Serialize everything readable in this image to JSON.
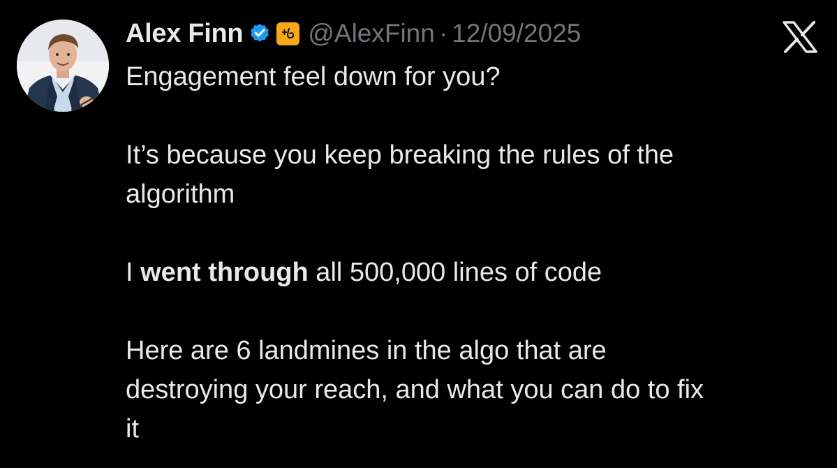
{
  "author": {
    "display_name": "Alex Finn",
    "handle": "@AlexFinn",
    "separator": "·",
    "timestamp": "12/09/2025",
    "verified_icon": "verified-badge-icon",
    "affiliate_icon": "affiliate-badge-icon",
    "avatar_icon": "profile-photo"
  },
  "platform": {
    "logo_icon": "x-logo-icon"
  },
  "tweet": {
    "line1": "Engagement feel down for you?",
    "para2_line1": "It’s because you keep breaking the rules of the",
    "para2_line2": "algorithm",
    "para3_prefix": "I ",
    "para3_bold": "went through",
    "para3_suffix": " all 500,000 lines of code",
    "para4_line1": "Here are 6 landmines in the algo that are",
    "para4_line2": "destroying your reach, and what you can do to fix",
    "para4_line3": "it"
  },
  "colors": {
    "background": "#000000",
    "primary_text": "#e7e9ea",
    "secondary_text": "#71767b",
    "verified_blue": "#1d9bf0",
    "affiliate_orange": "#f7a81b"
  }
}
